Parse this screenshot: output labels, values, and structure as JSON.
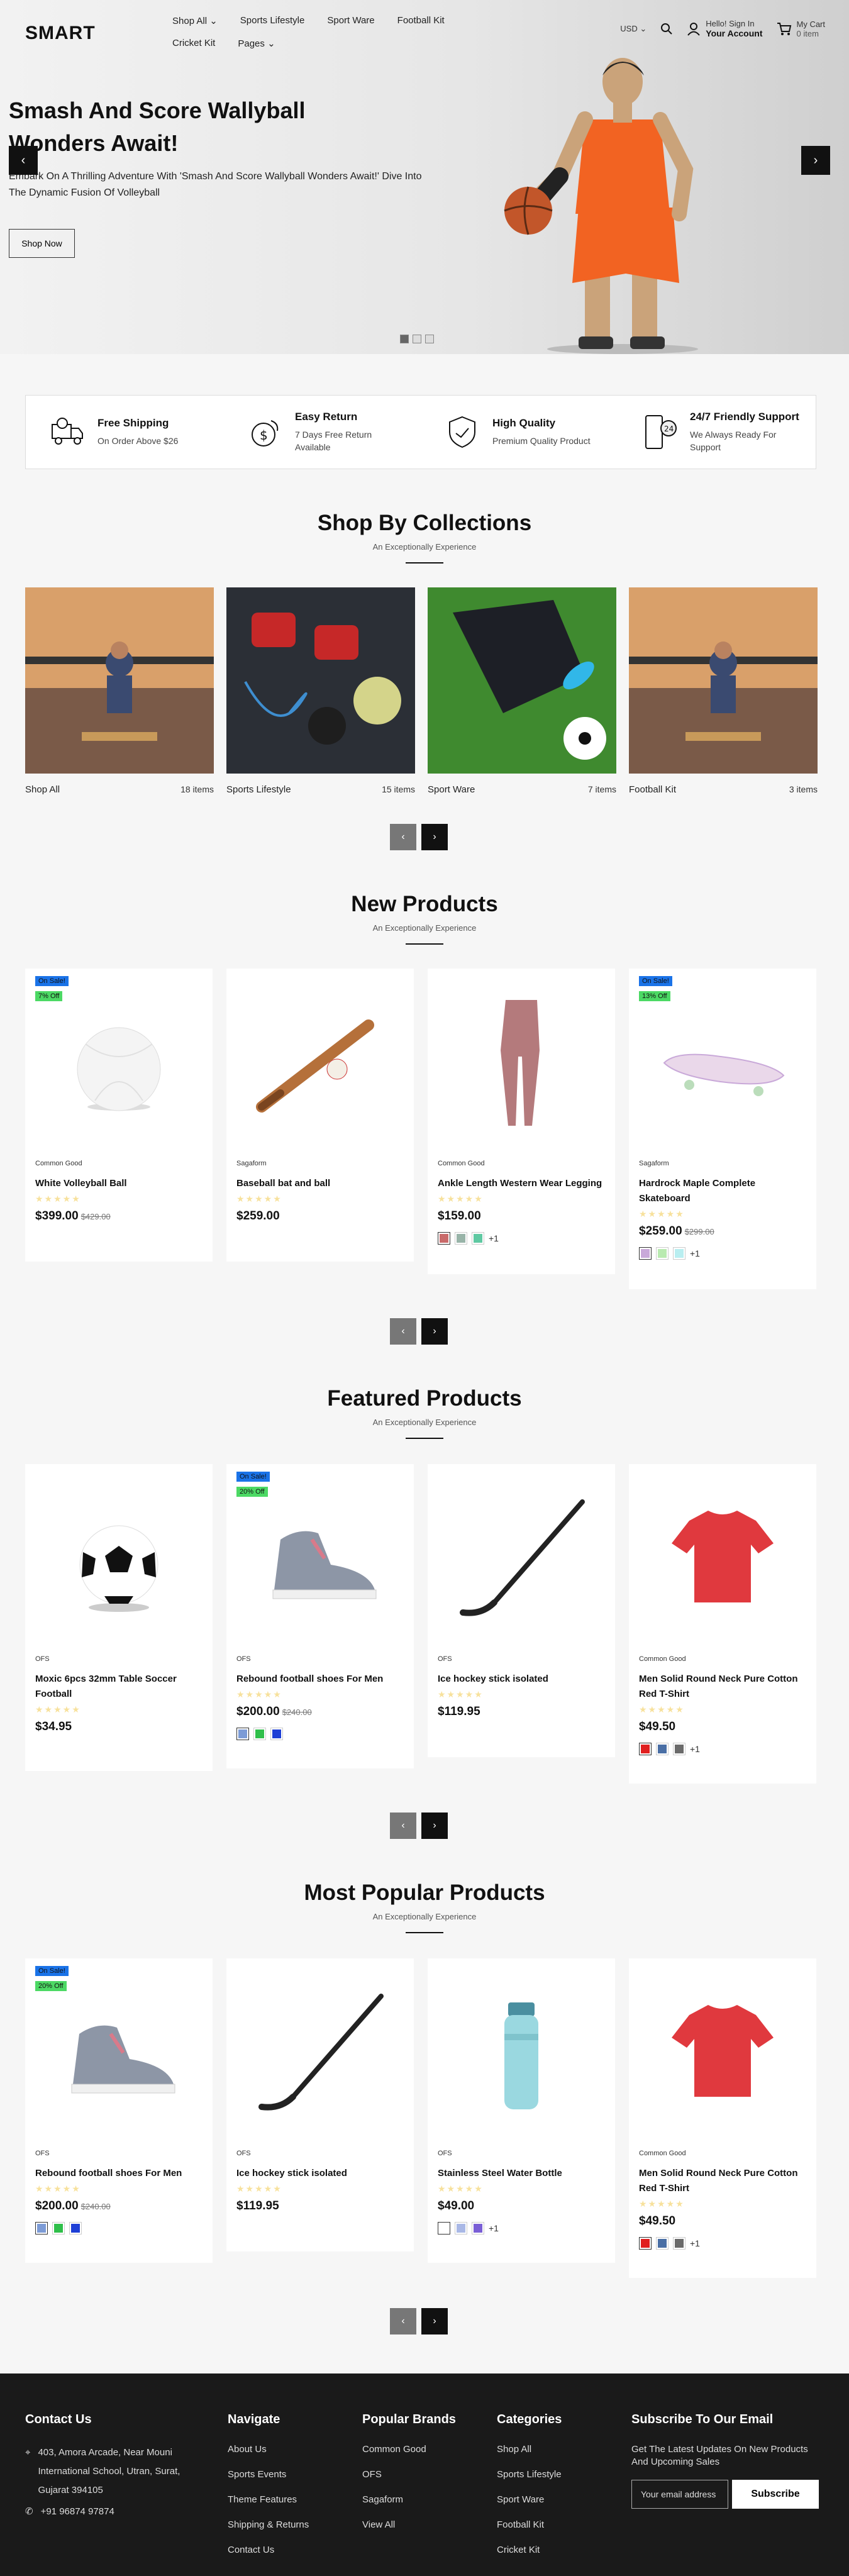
{
  "header": {
    "logo": "SMART",
    "nav": [
      {
        "label": "Shop All",
        "dropdown": true
      },
      {
        "label": "Sports Lifestyle",
        "dropdown": false
      },
      {
        "label": "Sport Ware",
        "dropdown": false
      },
      {
        "label": "Football Kit",
        "dropdown": false
      },
      {
        "label": "Cricket Kit",
        "dropdown": false
      },
      {
        "label": "Pages",
        "dropdown": true
      }
    ],
    "currency": "USD",
    "account_line1": "Hello! Sign In",
    "account_line2": "Your Account",
    "cart_line1": "My Cart",
    "cart_line2": "0 item"
  },
  "hero": {
    "title": "Smash And Score Wallyball Wonders Await!",
    "description": "Embark On A Thrilling Adventure With 'Smash And Score Wallyball Wonders Await!' Dive Into The Dynamic Fusion Of Volleyball",
    "button": "Shop Now",
    "slides": 3,
    "active_slide": 1
  },
  "features": [
    {
      "icon": "delivery-truck-icon",
      "title": "Free Shipping",
      "subtitle": "On Order Above $26"
    },
    {
      "icon": "money-return-icon",
      "title": "Easy Return",
      "subtitle": "7 Days Free Return Available"
    },
    {
      "icon": "quality-shield-icon",
      "title": "High Quality",
      "subtitle": "Premium Quality Product"
    },
    {
      "icon": "support-24-icon",
      "title": "24/7 Friendly Support",
      "subtitle": "We Always Ready For Support"
    }
  ],
  "collections": {
    "title": "Shop By Collections",
    "subtitle": "An Exceptionally Experience",
    "items": [
      {
        "name": "Shop All",
        "count": "18 items"
      },
      {
        "name": "Sports Lifestyle",
        "count": "15 items"
      },
      {
        "name": "Sport Ware",
        "count": "7 items"
      },
      {
        "name": "Football Kit",
        "count": "3 items"
      }
    ]
  },
  "new_products": {
    "title": "New Products",
    "subtitle": "An Exceptionally Experience",
    "items": [
      {
        "brand": "Common Good",
        "name": "White Volleyball Ball",
        "price": "$399.00",
        "old_price": "$429.00",
        "sale": "On Sale!",
        "off": "7% Off"
      },
      {
        "brand": "Sagaform",
        "name": "Baseball bat and ball",
        "price": "$259.00",
        "old_price": "",
        "sale": "",
        "off": ""
      },
      {
        "brand": "Common Good",
        "name": "Ankle Length Western Wear Legging",
        "price": "$159.00",
        "old_price": "",
        "sale": "",
        "off": "",
        "swatches": [
          "#c96a6a",
          "#98b4a8",
          "#5fc9a2"
        ],
        "more": "+1"
      },
      {
        "brand": "Sagaform",
        "name": "Hardrock Maple Complete Skateboard",
        "price": "$259.00",
        "old_price": "$299.00",
        "sale": "On Sale!",
        "off": "13% Off",
        "swatches": [
          "#c9a9d9",
          "#b9eab0",
          "#b9eef0"
        ],
        "more": "+1"
      }
    ]
  },
  "featured_products": {
    "title": "Featured Products",
    "subtitle": "An Exceptionally Experience",
    "items": [
      {
        "brand": "OFS",
        "name": "Moxic 6pcs 32mm Table Soccer Football",
        "price": "$34.95",
        "old_price": "",
        "sale": "",
        "off": ""
      },
      {
        "brand": "OFS",
        "name": "Rebound football shoes For Men",
        "price": "$200.00",
        "old_price": "$240.00",
        "sale": "On Sale!",
        "off": "20% Off",
        "swatches": [
          "#7c9bd6",
          "#2fbf4a",
          "#1e3fd6"
        ],
        "more": ""
      },
      {
        "brand": "OFS",
        "name": "Ice hockey stick isolated",
        "price": "$119.95",
        "old_price": "",
        "sale": "",
        "off": ""
      },
      {
        "brand": "Common Good",
        "name": "Men Solid Round Neck Pure Cotton Red T-Shirt",
        "price": "$49.50",
        "old_price": "",
        "sale": "",
        "off": "",
        "swatches": [
          "#e02020",
          "#4a6fa5",
          "#6b6b6b"
        ],
        "more": "+1"
      }
    ]
  },
  "popular_products": {
    "title": "Most Popular Products",
    "subtitle": "An Exceptionally Experience",
    "items": [
      {
        "brand": "OFS",
        "name": "Rebound football shoes For Men",
        "price": "$200.00",
        "old_price": "$240.00",
        "sale": "On Sale!",
        "off": "20% Off",
        "swatches": [
          "#7c9bd6",
          "#2fbf4a",
          "#1e3fd6"
        ],
        "more": ""
      },
      {
        "brand": "OFS",
        "name": "Ice hockey stick isolated",
        "price": "$119.95",
        "old_price": "",
        "sale": "",
        "off": ""
      },
      {
        "brand": "OFS",
        "name": "Stainless Steel Water Bottle",
        "price": "$49.00",
        "old_price": "",
        "sale": "",
        "off": "",
        "swatches": [
          "#ffffff",
          "#a9b8e6",
          "#7a5fd6"
        ],
        "more": "+1"
      },
      {
        "brand": "Common Good",
        "name": "Men Solid Round Neck Pure Cotton Red T-Shirt",
        "price": "$49.50",
        "old_price": "",
        "sale": "",
        "off": "",
        "swatches": [
          "#e02020",
          "#4a6fa5",
          "#6b6b6b"
        ],
        "more": "+1"
      }
    ]
  },
  "footer": {
    "contact": {
      "title": "Contact Us",
      "address": "403, Amora Arcade, Near Mouni International School, Utran, Surat, Gujarat 394105",
      "phone": "+91 96874 97874"
    },
    "navigate": {
      "title": "Navigate",
      "links": [
        "About Us",
        "Sports Events",
        "Theme Features",
        "Shipping & Returns",
        "Contact Us"
      ]
    },
    "brands": {
      "title": "Popular Brands",
      "links": [
        "Common Good",
        "OFS",
        "Sagaform",
        "View All"
      ]
    },
    "categories": {
      "title": "Categories",
      "links": [
        "Shop All",
        "Sports Lifestyle",
        "Sport Ware",
        "Football Kit",
        "Cricket Kit"
      ]
    },
    "subscribe": {
      "title": "Subscribe To Our Email",
      "text": "Get The Latest Updates On New Products And Upcoming Sales",
      "placeholder": "Your email address",
      "button": "Subscribe"
    }
  }
}
